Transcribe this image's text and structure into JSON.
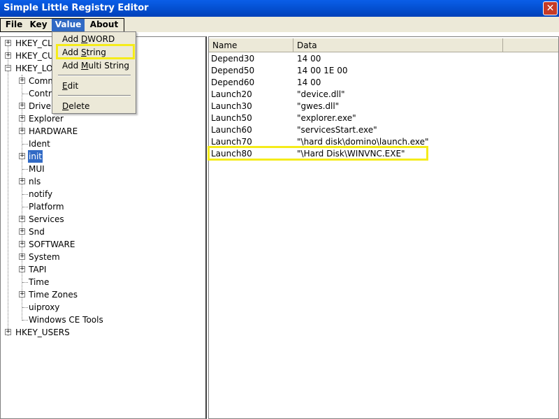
{
  "window": {
    "title": "Simple Little Registry Editor",
    "close_glyph": "✕"
  },
  "menubar": {
    "items": [
      {
        "label": "File"
      },
      {
        "label": "Key"
      },
      {
        "label": "Value"
      },
      {
        "label": "About"
      }
    ]
  },
  "value_menu": {
    "items": [
      {
        "pre": "Add ",
        "u": "D",
        "post": "WORD"
      },
      {
        "pre": "Add ",
        "u": "S",
        "post": "tring"
      },
      {
        "pre": "Add ",
        "u": "M",
        "post": "ulti String"
      },
      {
        "pre": "",
        "u": "E",
        "post": "dit"
      },
      {
        "pre": "",
        "u": "D",
        "post": "elete"
      }
    ]
  },
  "tree": {
    "roots": [
      {
        "label": "HKEY_CL"
      },
      {
        "label": "HKEY_CU"
      },
      {
        "label": "HKEY_LO"
      },
      {
        "label": "HKEY_USERS"
      }
    ],
    "children": [
      {
        "label": "Comm"
      },
      {
        "label": "Contro"
      },
      {
        "label": "Driver"
      },
      {
        "label": "Explorer"
      },
      {
        "label": "HARDWARE"
      },
      {
        "label": "Ident"
      },
      {
        "label": "init"
      },
      {
        "label": "MUI"
      },
      {
        "label": "nls"
      },
      {
        "label": "notify"
      },
      {
        "label": "Platform"
      },
      {
        "label": "Services"
      },
      {
        "label": "Snd"
      },
      {
        "label": "SOFTWARE"
      },
      {
        "label": "System"
      },
      {
        "label": "TAPI"
      },
      {
        "label": "Time"
      },
      {
        "label": "Time Zones"
      },
      {
        "label": "uiproxy"
      },
      {
        "label": "Windows CE Tools"
      }
    ]
  },
  "list": {
    "columns": [
      "Name",
      "Data"
    ],
    "rows": [
      {
        "name": "Depend30",
        "data": "14 00"
      },
      {
        "name": "Depend50",
        "data": "14 00 1E 00"
      },
      {
        "name": "Depend60",
        "data": "14 00"
      },
      {
        "name": "Launch20",
        "data": "\"device.dll\""
      },
      {
        "name": "Launch30",
        "data": "\"gwes.dll\""
      },
      {
        "name": "Launch50",
        "data": "\"explorer.exe\""
      },
      {
        "name": "Launch60",
        "data": "\"servicesStart.exe\""
      },
      {
        "name": "Launch70",
        "data": "\"\\hard disk\\domino\\launch.exe\""
      },
      {
        "name": "Launch80",
        "data": "\"\\Hard Disk\\WINVNC.EXE\""
      }
    ]
  },
  "colors": {
    "highlight": "#f5ec1a",
    "selection": "#316ac5",
    "titlebar": "#0553d6"
  }
}
